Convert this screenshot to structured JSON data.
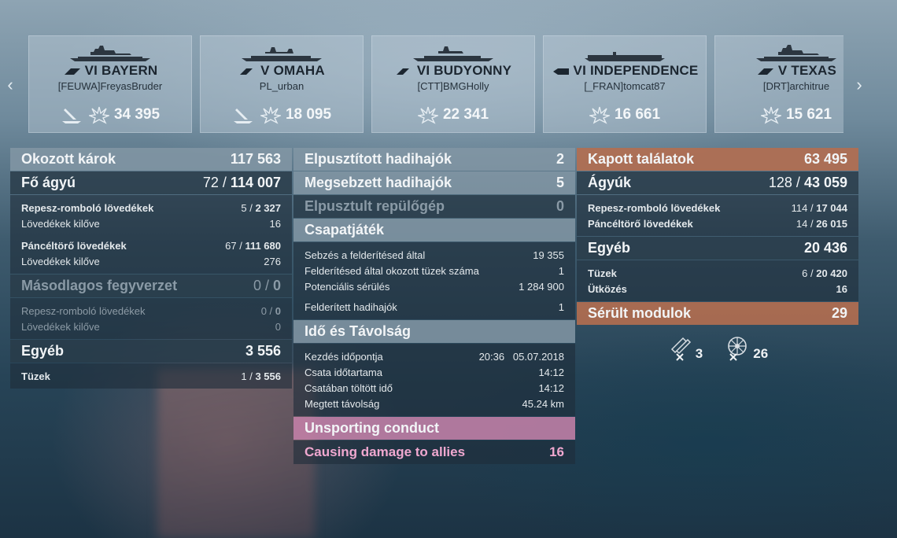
{
  "ships": [
    {
      "tier": "VI",
      "name": "BAYERN",
      "class": "battleship",
      "player": "[FEUWA]FreyasBruder",
      "icons": [
        "torpedo-hit-icon",
        "fire-explosion-icon"
      ],
      "damage": "34 395"
    },
    {
      "tier": "V",
      "name": "OMAHA",
      "class": "cruiser",
      "player": "PL_urban",
      "icons": [
        "torpedo-hit-icon",
        "fire-explosion-icon"
      ],
      "damage": "18 095"
    },
    {
      "tier": "VI",
      "name": "BUDYONNY",
      "class": "cruiser",
      "player": "[CTT]BMGHolly",
      "icons": [
        "fire-explosion-icon"
      ],
      "damage": "22 341"
    },
    {
      "tier": "VI",
      "name": "INDEPENDENCE",
      "class": "carrier",
      "player": "[_FRAN]tomcat87",
      "icons": [
        "fire-explosion-icon"
      ],
      "damage": "16 661"
    },
    {
      "tier": "V",
      "name": "TEXAS",
      "class": "battleship",
      "player": "[DRT]architrue",
      "icons": [
        "fire-explosion-icon"
      ],
      "damage": "15 621"
    }
  ],
  "left": {
    "caused_damage": {
      "label": "Okozott károk",
      "value": "117 563"
    },
    "main_battery": {
      "label": "Fő ágyú",
      "hits": "72",
      "value": "114 007"
    },
    "he_shells": {
      "label": "Repesz-romboló lövedékek",
      "hits": "5",
      "value": "2 327"
    },
    "he_fired": {
      "label": "Lövedékek kilőve",
      "value": "16"
    },
    "ap_shells": {
      "label": "Páncéltörő lövedékek",
      "hits": "67",
      "value": "111 680"
    },
    "ap_fired": {
      "label": "Lövedékek kilőve",
      "value": "276"
    },
    "secondary": {
      "label": "Másodlagos fegyverzet",
      "hits": "0",
      "value": "0"
    },
    "sec_he": {
      "label": "Repesz-romboló lövedékek",
      "hits": "0",
      "value": "0"
    },
    "sec_fired": {
      "label": "Lövedékek kilőve",
      "value": "0"
    },
    "other": {
      "label": "Egyéb",
      "value": "3 556"
    },
    "fires": {
      "label": "Tüzek",
      "hits": "1",
      "value": "3 556"
    }
  },
  "middle": {
    "destroyed": {
      "label": "Elpusztított hadihajók",
      "value": "2"
    },
    "damaged": {
      "label": "Megsebzett hadihajók",
      "value": "5"
    },
    "planes": {
      "label": "Elpusztult repülőgép",
      "value": "0"
    },
    "teamplay": {
      "label": "Csapatjáték"
    },
    "spot_damage": {
      "label": "Sebzés a felderítésed által",
      "value": "19 355"
    },
    "spot_fires": {
      "label": "Felderítésed által okozott tüzek száma",
      "value": "1"
    },
    "potential": {
      "label": "Potenciális sérülés",
      "value": "1 284 900"
    },
    "spotted": {
      "label": "Felderített hadihajók",
      "value": "1"
    },
    "time_distance": {
      "label": "Idő és Távolság"
    },
    "start": {
      "label": "Kezdés időpontja",
      "value": "20:36   05.07.2018"
    },
    "duration": {
      "label": "Csata időtartama",
      "value": "14:12"
    },
    "time_in_battle": {
      "label": "Csatában töltött idő",
      "value": "14:12"
    },
    "distance": {
      "label": "Megtett távolság",
      "value": "45.24 km"
    },
    "unsporting": {
      "label": "Unsporting conduct"
    },
    "ally_damage": {
      "label": "Causing damage to allies",
      "value": "16"
    }
  },
  "right": {
    "received": {
      "label": "Kapott találatok",
      "value": "63 495"
    },
    "guns": {
      "label": "Ágyúk",
      "hits": "128",
      "value": "43 059"
    },
    "he_shells": {
      "label": "Repesz-romboló lövedékek",
      "hits": "114",
      "value": "17 044"
    },
    "ap_shells": {
      "label": "Páncéltörő lövedékek",
      "hits": "14",
      "value": "26 015"
    },
    "other": {
      "label": "Egyéb",
      "value": "20 436"
    },
    "fires": {
      "label": "Tüzek",
      "hits": "6",
      "value": "20 420"
    },
    "collision": {
      "label": "Ütközés",
      "value": "16"
    },
    "modules": {
      "label": "Sérült modulok",
      "value": "29"
    },
    "module_items": [
      {
        "icon": "gun-turret-icon",
        "count": "3"
      },
      {
        "icon": "steering-gear-icon",
        "count": "26"
      }
    ]
  },
  "colors": {
    "orange": "#b46e50",
    "pink": "#c882aa",
    "pink_text": "#f0a8d0"
  }
}
